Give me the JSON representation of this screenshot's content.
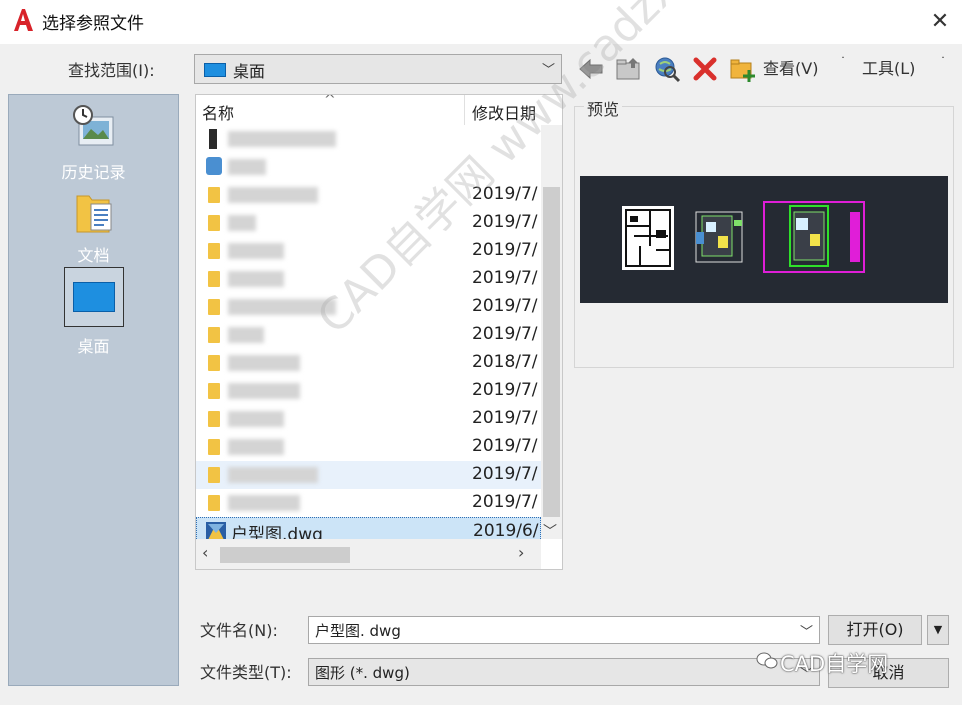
{
  "window": {
    "title": "选择参照文件",
    "close_glyph": "✕",
    "logo_icon": "autocad-logo-icon"
  },
  "lookin": {
    "label": "查找范围(I):",
    "value": "桌面"
  },
  "toolbar": {
    "icons": [
      "back-arrow-icon",
      "up-folder-icon",
      "search-web-icon",
      "delete-icon",
      "new-folder-icon"
    ],
    "view_label": "查看(V)",
    "tools_label": "工具(L)"
  },
  "places": {
    "history": "历史记录",
    "documents": "文档",
    "desktop": "桌面"
  },
  "filelist": {
    "col_name": "名称",
    "col_date": "修改日期",
    "rows": [
      {
        "date": ""
      },
      {
        "date": ""
      },
      {
        "date": "2019/7/"
      },
      {
        "date": "2019/7/"
      },
      {
        "date": "2019/7/"
      },
      {
        "date": "2019/7/"
      },
      {
        "date": "2019/7/"
      },
      {
        "date": "2019/7/"
      },
      {
        "date": "2018/7/"
      },
      {
        "date": "2019/7/"
      },
      {
        "date": "2019/7/"
      },
      {
        "date": "2019/7/"
      },
      {
        "date": "2019/7/"
      },
      {
        "date": "2019/7/"
      },
      {
        "name": "户型图.dwg",
        "date": "2019/6/"
      }
    ]
  },
  "preview": {
    "label": "预览"
  },
  "bottom": {
    "filename_label": "文件名(N):",
    "filename_value": "户型图. dwg",
    "open_label": "打开(O)",
    "filetype_label": "文件类型(T):",
    "filetype_value": "图形 (*. dwg)",
    "cancel_label": "取消"
  },
  "watermark": {
    "diagonal": "CAD自学网 www.cadzxw.com",
    "corner": "CAD自学网"
  }
}
